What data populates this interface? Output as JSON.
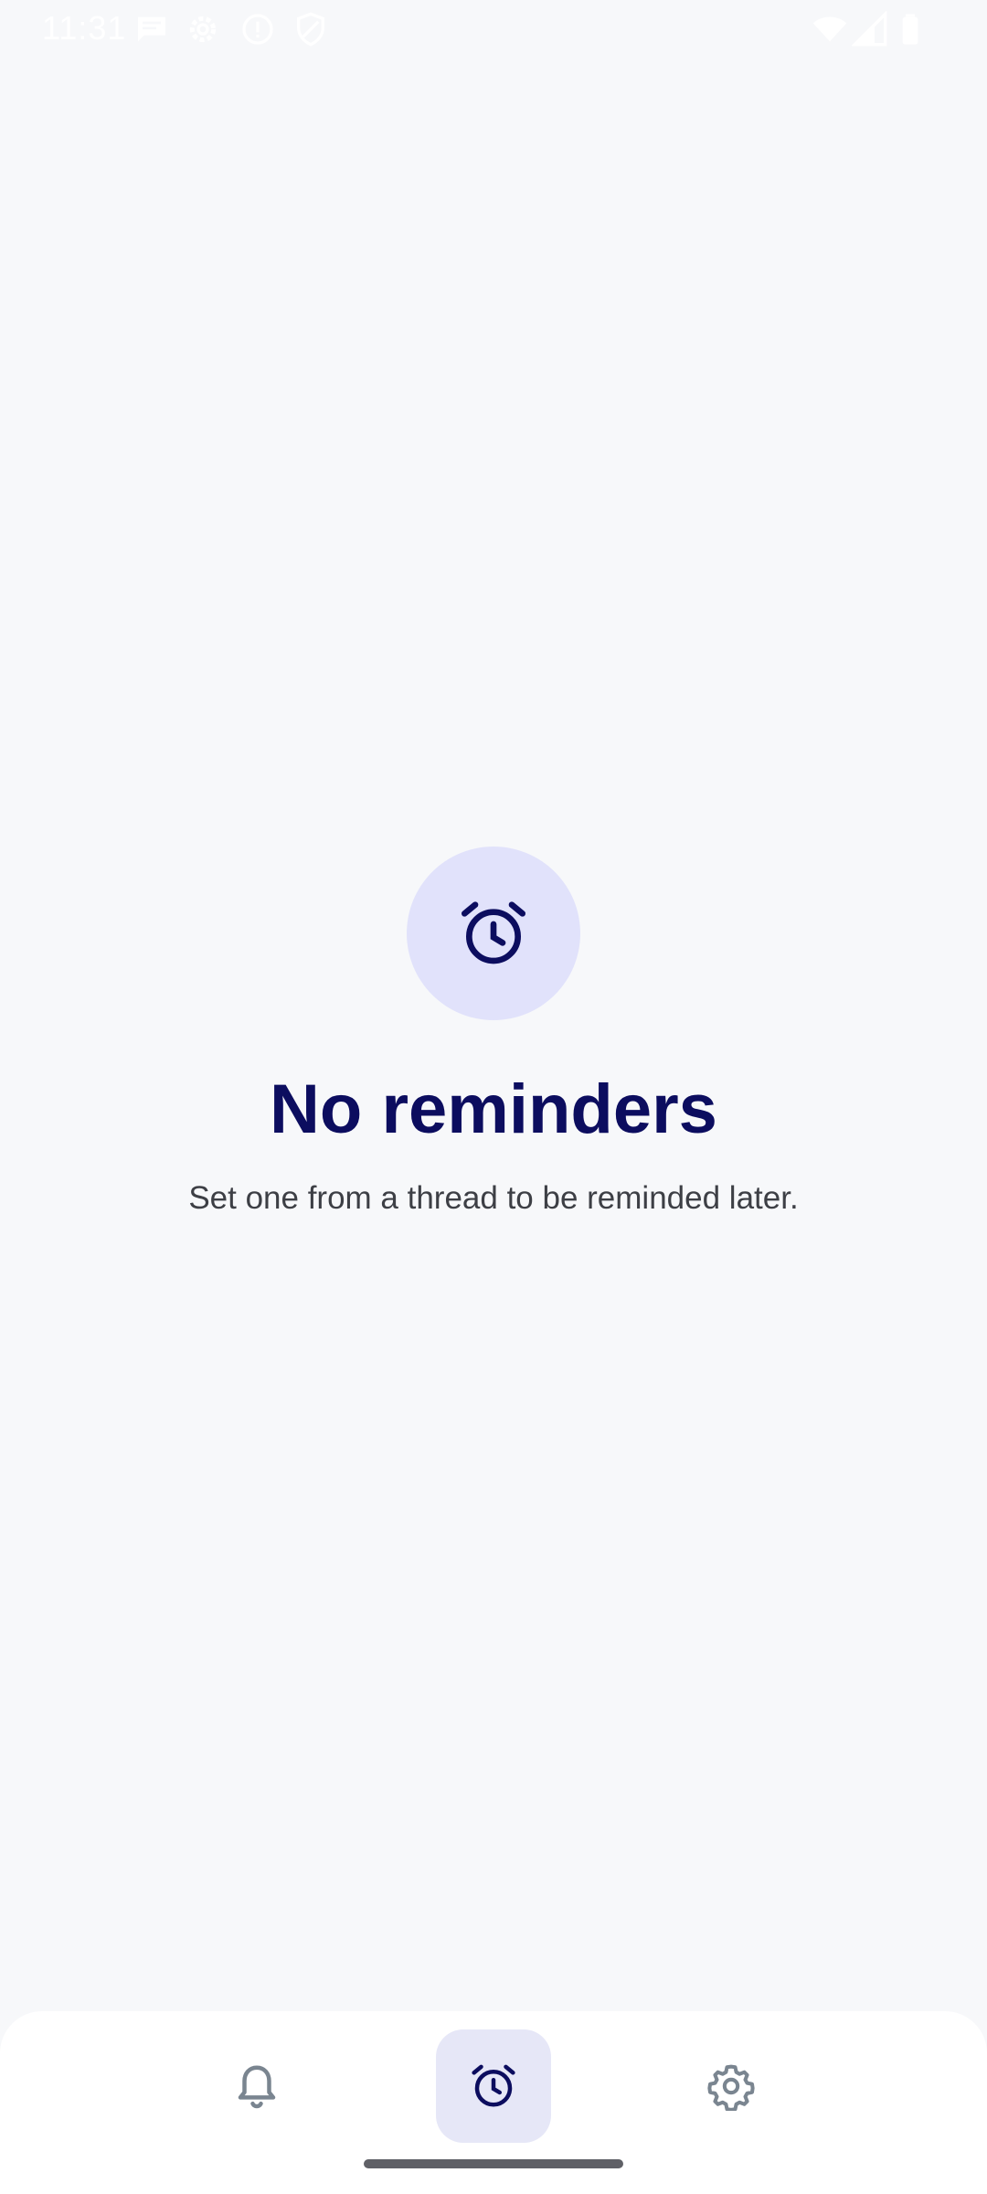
{
  "status_bar": {
    "time": "11:31",
    "icons": [
      "message-icon",
      "settings-gear-icon",
      "alert-circle-icon",
      "shield-icon",
      "wifi-icon",
      "signal-icon",
      "battery-icon"
    ]
  },
  "empty_state": {
    "icon": "alarm-clock-icon",
    "title": "No reminders",
    "subtitle": "Set one from a thread to be reminded later."
  },
  "bottom_nav": {
    "items": [
      {
        "icon": "bell-icon",
        "active": false
      },
      {
        "icon": "alarm-clock-icon",
        "active": true
      },
      {
        "icon": "gear-icon",
        "active": false
      }
    ]
  },
  "colors": {
    "background": "#f7f8fa",
    "title": "#0c0d5f",
    "accent_badge": "#e1e2fb",
    "nav_active": "#e6e7f7",
    "nav_icon_inactive": "#7a8590"
  }
}
